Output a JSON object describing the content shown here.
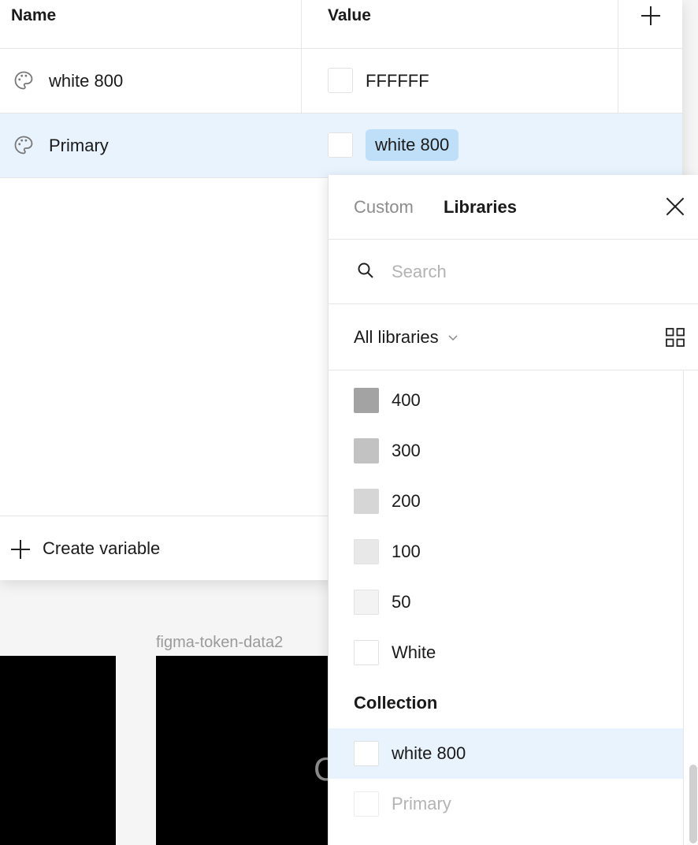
{
  "table": {
    "header": {
      "name": "Name",
      "value": "Value"
    },
    "rows": [
      {
        "name": "white 800",
        "value": "FFFFFF",
        "swatch": "#FFFFFF"
      },
      {
        "name": "Primary",
        "value": "white 800",
        "swatch": "#FFFFFF"
      }
    ],
    "create_label": "Create variable"
  },
  "canvas": {
    "frame_label": "figma-token-data2",
    "frame_text": "C"
  },
  "picker": {
    "tabs": {
      "custom": "Custom",
      "libraries": "Libraries"
    },
    "search": {
      "placeholder": "Search",
      "value": ""
    },
    "filter": {
      "label": "All libraries"
    },
    "colors": [
      {
        "label": "400",
        "color": "#A3A3A3"
      },
      {
        "label": "300",
        "color": "#C2C2C2"
      },
      {
        "label": "200",
        "color": "#D6D6D6"
      },
      {
        "label": "100",
        "color": "#E8E8E8"
      },
      {
        "label": "50",
        "color": "#F3F3F3"
      },
      {
        "label": "White",
        "color": "#FFFFFF"
      }
    ],
    "collection_heading": "Collection",
    "collection_items": [
      {
        "label": "white 800",
        "color": "#FFFFFF",
        "selected": true
      },
      {
        "label": "Primary",
        "color": "#FFFFFF",
        "muted": true
      }
    ]
  },
  "colors": {
    "selection": "#E8F3FD",
    "pill": "#BFDFF9"
  }
}
